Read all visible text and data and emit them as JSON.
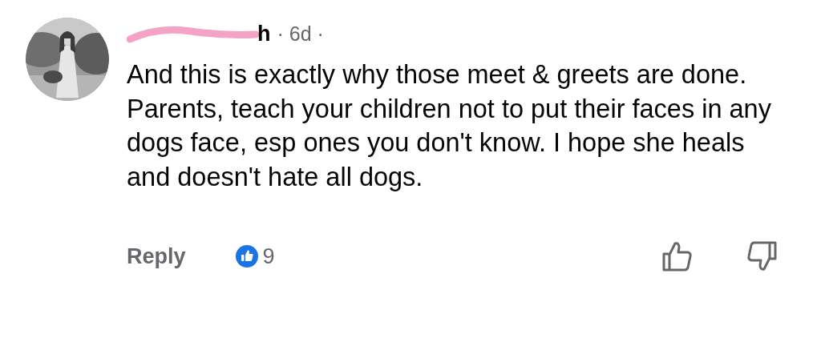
{
  "comment": {
    "author_visible": "h",
    "redacted": true,
    "time": "· 6d ·",
    "body": "And this is exactly why those meet & greets are done. Parents, teach your children not to put their faces in any dogs face, esp ones you don't know. I hope she heals and doesn't hate all dogs."
  },
  "actions": {
    "reply": "Reply",
    "reaction_count": "9"
  }
}
